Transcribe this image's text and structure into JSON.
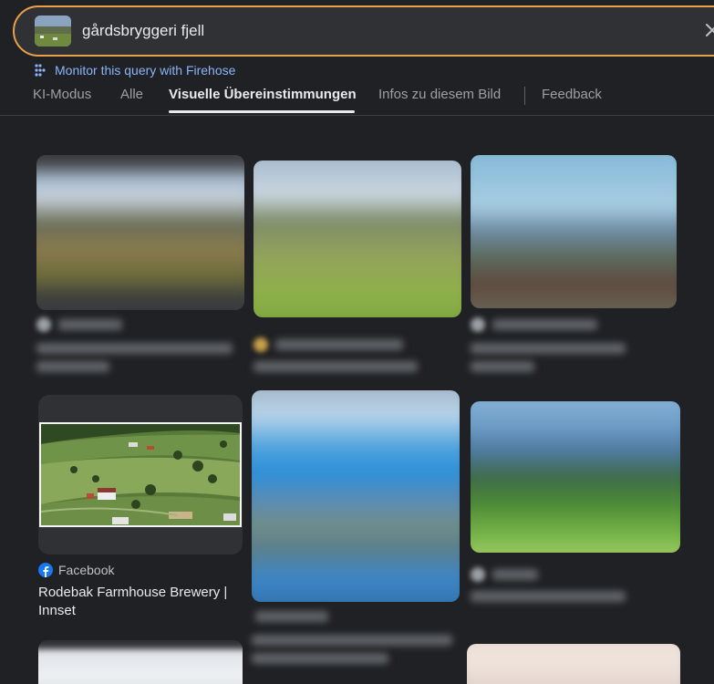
{
  "search": {
    "query": "gårdsbryggeri fjell"
  },
  "firehose": {
    "label": "Monitor this query with Firehose"
  },
  "tabs": [
    {
      "label": "KI-Modus"
    },
    {
      "label": "Alle"
    },
    {
      "label": "Visuelle Übereinstimmungen",
      "active": true
    },
    {
      "label": "Infos zu diesem Bild"
    },
    {
      "label": "Feedback"
    }
  ],
  "result_card": {
    "source": "Facebook",
    "title": "Rodebak Farmhouse Brewery | Innset"
  },
  "colors": {
    "accent_border": "#e8a14a",
    "link": "#8ab4f8",
    "facebook": "#1877f2",
    "background": "#202124"
  }
}
